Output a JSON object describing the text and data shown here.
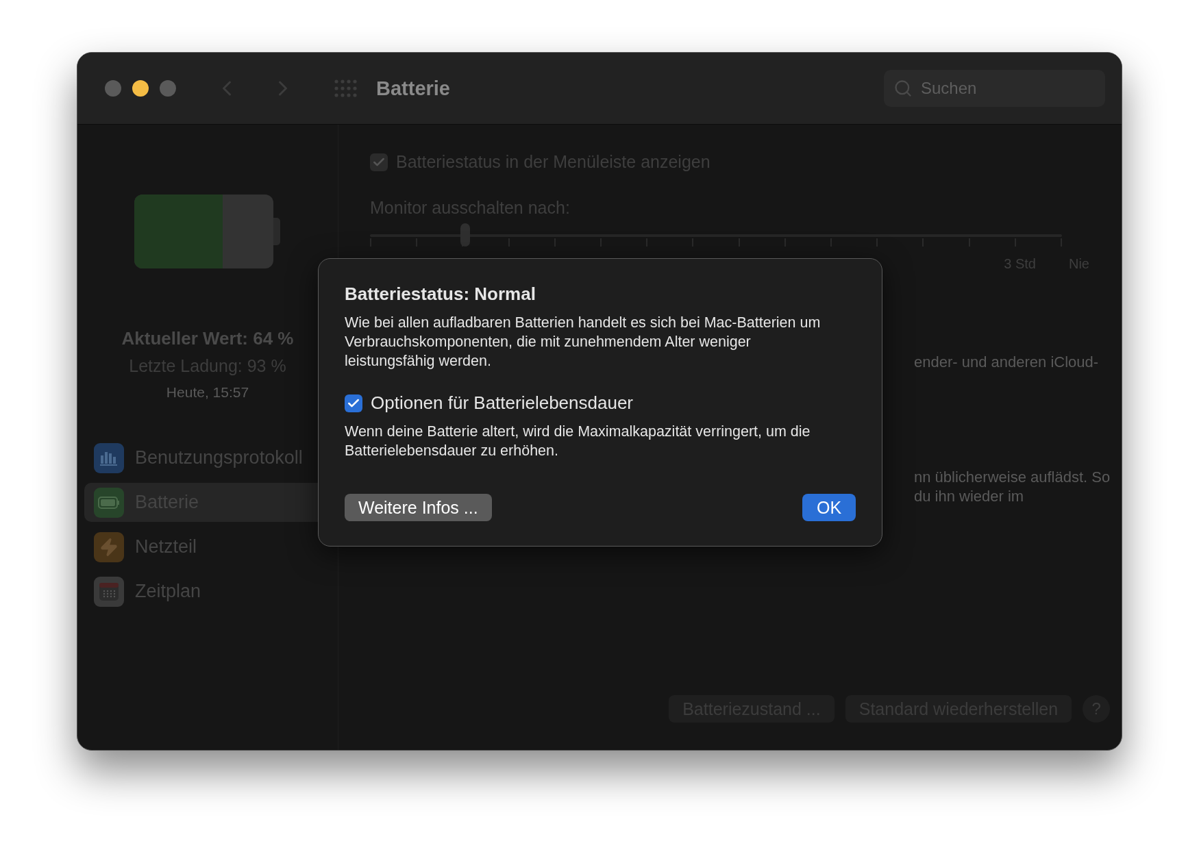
{
  "window": {
    "title": "Batterie"
  },
  "search": {
    "placeholder": "Suchen"
  },
  "battery": {
    "level": 0.64,
    "current": "Aktueller Wert: 64 %",
    "last_charge": "Letzte Ladung: 93 %",
    "time": "Heute, 15:57"
  },
  "sidebar": {
    "items": [
      {
        "label": "Benutzungsprotokoll",
        "kind": "chart",
        "color": "#1f3a5f",
        "selected": false
      },
      {
        "label": "Batterie",
        "kind": "battery",
        "color": "#27452a",
        "selected": true
      },
      {
        "label": "Netzteil",
        "kind": "bolt",
        "color": "#4a3518",
        "selected": false
      },
      {
        "label": "Zeitplan",
        "kind": "calendar",
        "color": "#3a3a3a",
        "selected": false
      }
    ]
  },
  "menu_bar_option": {
    "label": "Batteriestatus in der Menüleiste anzeigen",
    "checked": true
  },
  "monitor_off": {
    "label": "Monitor ausschalten nach:",
    "level": 0.138,
    "tick_labels": [
      "3 Std",
      "Nie"
    ]
  },
  "partial_texts": [
    "ender- und anderen iCloud-",
    "nn üblicherweise auflädst. So",
    "du ihn wieder im"
  ],
  "buttons": [
    "Batteriezustand ...",
    "Standard wiederherstellen",
    "?"
  ],
  "dialog": {
    "title": "Batteriestatus: Normal",
    "text": "Wie bei allen aufladbaren Batterien handelt es sich bei Mac-Batterien um Verbrauchskomponenten, die mit zunehmendem Alter weniger leistungsfähig werden.",
    "option": {
      "label": "Optionen für Batterielebensdauer",
      "checked": true
    },
    "option_text": "Wenn deine Batterie altert, wird die Maximalkapazität verringert, um die Batterielebensdauer zu erhöhen.",
    "buttons": [
      "Weitere Infos ...",
      "OK"
    ]
  }
}
